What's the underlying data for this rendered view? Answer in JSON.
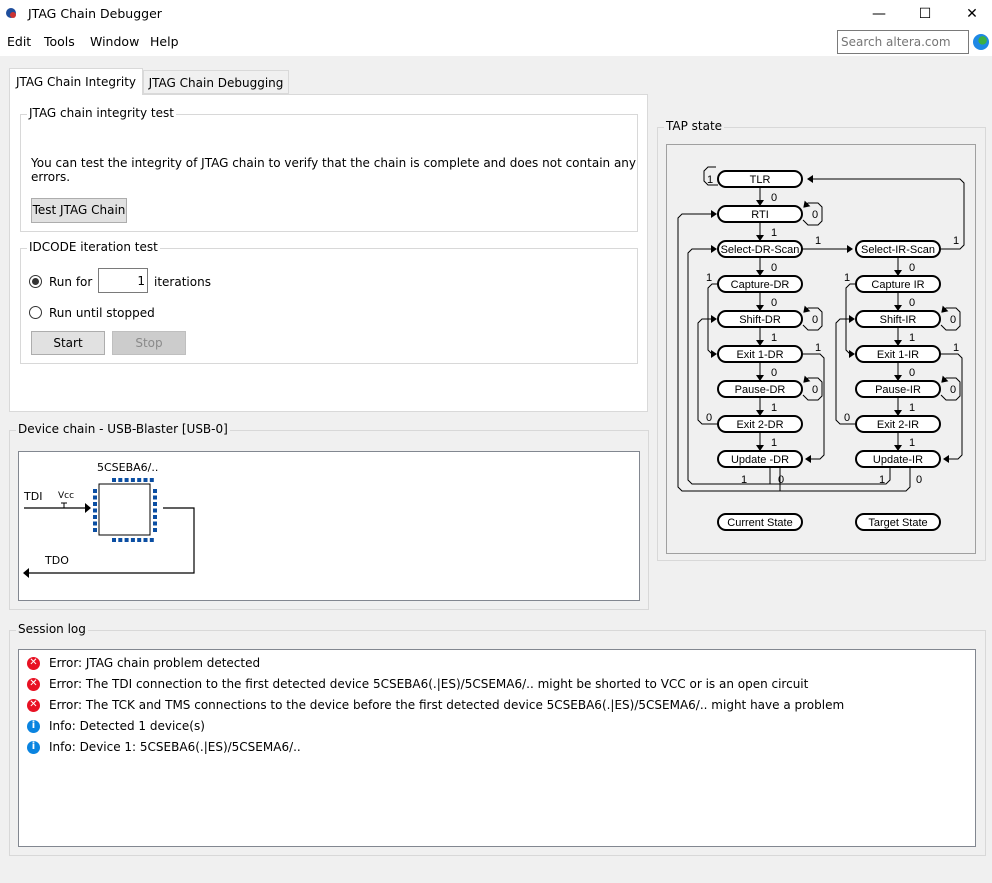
{
  "window": {
    "title": "JTAG Chain Debugger",
    "minimize": "—",
    "maximize": "☐",
    "close": "✕"
  },
  "menu": [
    "Edit",
    "Tools",
    "Window",
    "Help"
  ],
  "search": {
    "placeholder": "Search altera.com",
    "value": ""
  },
  "tabs": [
    {
      "label": "JTAG Chain Integrity",
      "active": true
    },
    {
      "label": "JTAG Chain Debugging",
      "active": false
    }
  ],
  "integrity": {
    "title": "JTAG chain integrity test",
    "description": "You can test the integrity of JTAG chain to verify that the chain is complete and does not contain any errors.",
    "button": "Test JTAG Chain"
  },
  "idcode": {
    "title": "IDCODE iteration test",
    "run_for_label": "Run for",
    "iterations_value": "1",
    "iterations_label": "iterations",
    "run_until_label": "Run until stopped",
    "selected": "run_for",
    "start": "Start",
    "stop": "Stop"
  },
  "device_chain": {
    "title": "Device chain - USB-Blaster [USB-0]",
    "device_name": "5CSEBA6/..",
    "tdi": "TDI",
    "tdo": "TDO",
    "vcc": "Vcc"
  },
  "tap": {
    "title": "TAP state",
    "states": [
      "TLR",
      "RTI",
      "Select-DR-Scan",
      "Capture-DR",
      "Shift-DR",
      "Exit 1-DR",
      "Pause-DR",
      "Exit 2-DR",
      "Update -DR",
      "Select-IR-Scan",
      "Capture IR",
      "Shift-IR",
      "Exit 1-IR",
      "Pause-IR",
      "Exit 2-IR",
      "Update-IR"
    ],
    "legend": [
      "Current State",
      "Target State"
    ],
    "transition_labels": [
      "1",
      "0",
      "0",
      "1",
      "1",
      "0",
      "1",
      "0",
      "0",
      "1",
      "1",
      "0",
      "0",
      "1",
      "0",
      "1",
      "1",
      "0",
      "1",
      "0",
      "1",
      "0",
      "0",
      "1",
      "1",
      "0",
      "0",
      "1",
      "0",
      "1",
      "1",
      "0"
    ]
  },
  "session_log": {
    "title": "Session log",
    "entries": [
      {
        "type": "error",
        "text": "Error: JTAG chain problem detected"
      },
      {
        "type": "error",
        "text": "Error: The TDI connection to the first detected device 5CSEBA6(.|ES)/5CSEMA6/.. might be shorted to VCC or is an open circuit"
      },
      {
        "type": "error",
        "text": "Error: The TCK and TMS connections to the device before the first detected device 5CSEBA6(.|ES)/5CSEMA6/.. might have a problem"
      },
      {
        "type": "info",
        "text": "Info: Detected 1 device(s)"
      },
      {
        "type": "info",
        "text": "Info: Device 1: 5CSEBA6(.|ES)/5CSEMA6/.."
      }
    ]
  },
  "colors": {
    "error": "#e81123",
    "info": "#0a84e0",
    "chip_pins": "#0b4ea2"
  }
}
